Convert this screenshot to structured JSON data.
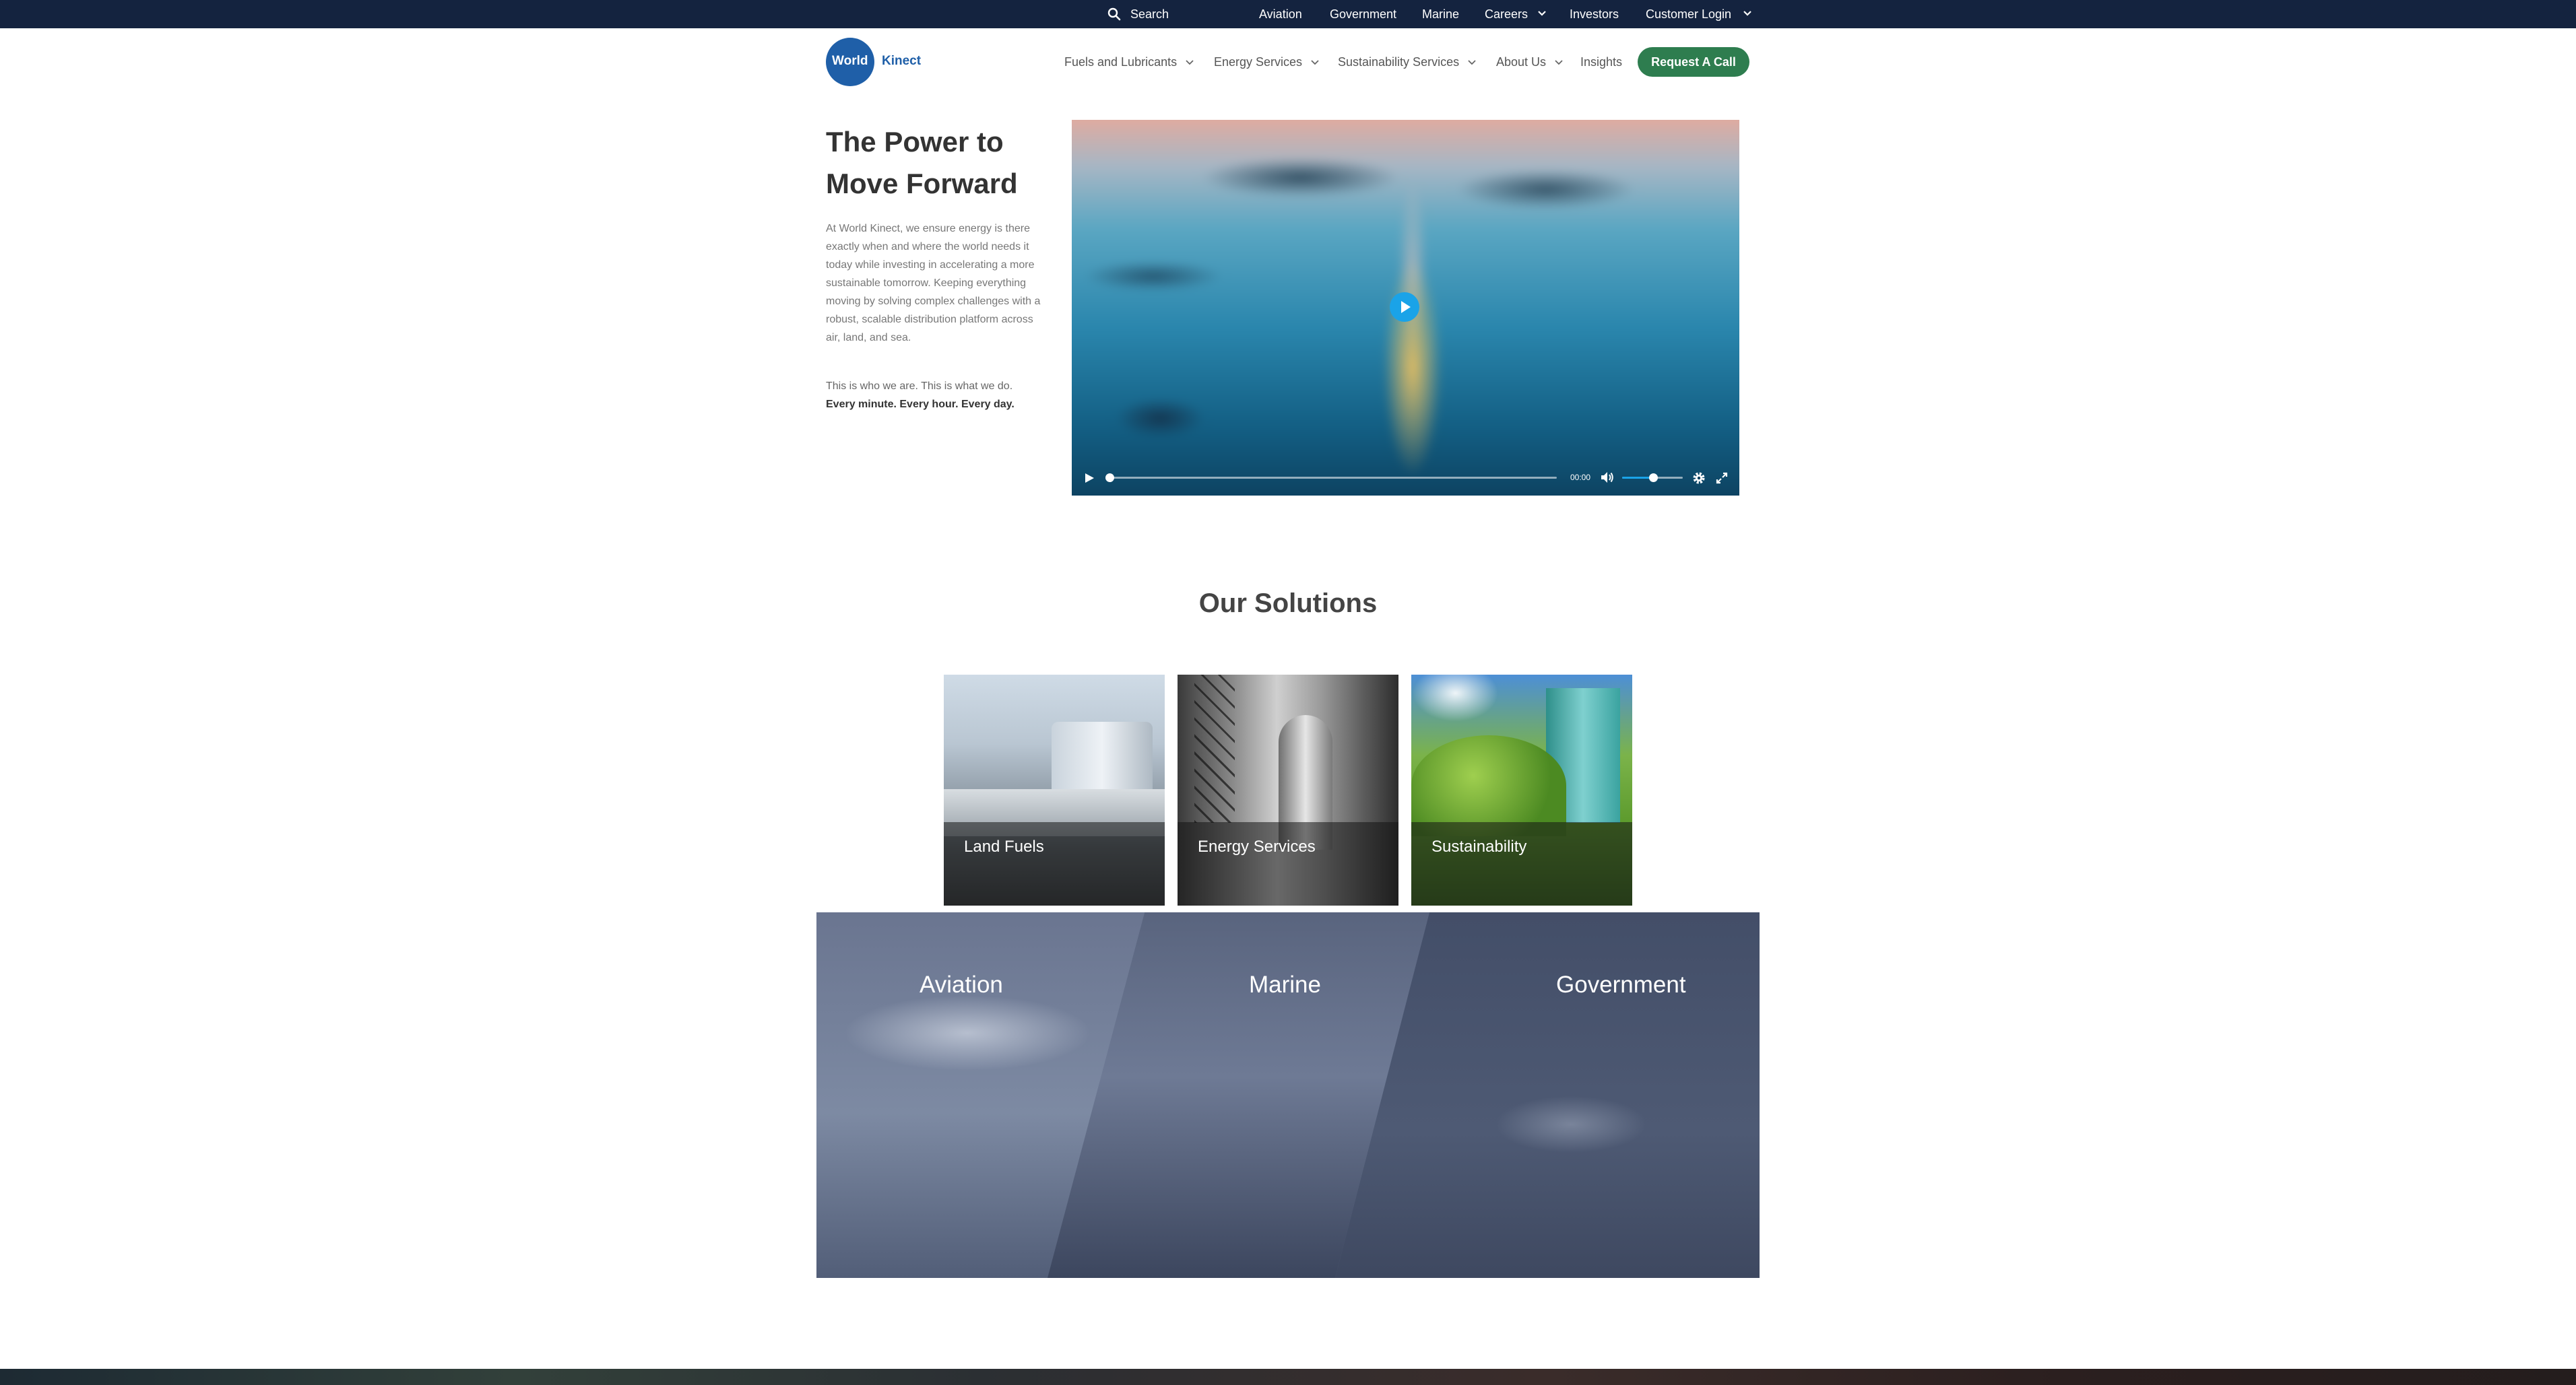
{
  "topbar": {
    "search_label": "Search",
    "links": {
      "aviation": "Aviation",
      "government": "Government",
      "marine": "Marine",
      "careers": "Careers",
      "investors": "Investors",
      "customer_login": "Customer Login"
    },
    "background_color": "#14233f"
  },
  "header": {
    "logo": {
      "circle_text": "World",
      "suffix_text": "Kinect",
      "color": "#1f5fa8"
    },
    "nav": {
      "fuels": "Fuels and Lubricants",
      "energy": "Energy Services",
      "sustainability": "Sustainability Services",
      "about": "About Us",
      "insights": "Insights"
    },
    "cta_label": "Request A Call",
    "cta_color": "#2e7d4f"
  },
  "hero": {
    "title": "The Power to Move Forward",
    "body": "At World Kinect, we ensure energy is there exactly when and where the world needs it today while investing in accelerating a more sustainable tomorrow. Keeping everything moving by solving complex challenges with a robust, scalable distribution platform across air, land, and sea.",
    "p2": "This is who we are. This is what we do.",
    "p2_bold": "Every minute. Every hour. Every day.",
    "video": {
      "time": "00:00",
      "progress": 0,
      "volume": 0.5,
      "accent_color": "#1aa3e8"
    }
  },
  "solutions": {
    "title": "Our Solutions",
    "cards": [
      {
        "label": "Land Fuels"
      },
      {
        "label": "Energy Services"
      },
      {
        "label": "Sustainability"
      }
    ],
    "segments": [
      {
        "label": "Aviation"
      },
      {
        "label": "Marine"
      },
      {
        "label": "Government"
      }
    ]
  }
}
